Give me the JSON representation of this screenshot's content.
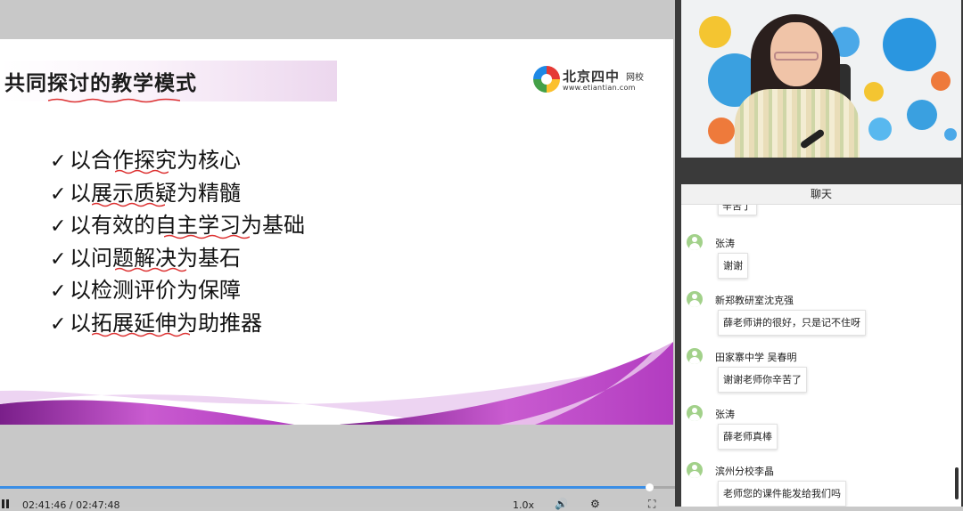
{
  "slide": {
    "title": "共同探讨的教学模式",
    "logo_name": "北京四中",
    "logo_school": "网校",
    "logo_url": "www.etiantian.com",
    "check_glyph": "✓",
    "bullets": [
      "以合作探究为核心",
      "以展示质疑为精髓",
      "以有效的自主学习为基础",
      "以问题解决为基石",
      "以检测评价为保障",
      "以拓展延伸为助推器"
    ]
  },
  "player": {
    "time": "02:41:46 / 02:47:48",
    "progress": 0.962,
    "speed": "1.0x",
    "icons": [
      "pause-icon",
      "volume-icon",
      "settings-icon",
      "fullscreen-icon"
    ]
  },
  "chat": {
    "header": "聊天",
    "partial_text": "辛苦了",
    "messages": [
      {
        "sender": "张涛",
        "text": "谢谢"
      },
      {
        "sender": "新郑教研室沈克强",
        "text": "薛老师讲的很好，只是记不住呀"
      },
      {
        "sender": "田家寨中学 吴春明",
        "text": "谢谢老师你辛苦了"
      },
      {
        "sender": "张涛",
        "text": "薛老师真棒"
      },
      {
        "sender": "滨州分校李晶",
        "text": "老师您的课件能发给我们吗"
      }
    ]
  },
  "colors": {
    "accent": "#b23cc0",
    "progress": "#3a8ee6",
    "avatar": "#a2d18a"
  }
}
